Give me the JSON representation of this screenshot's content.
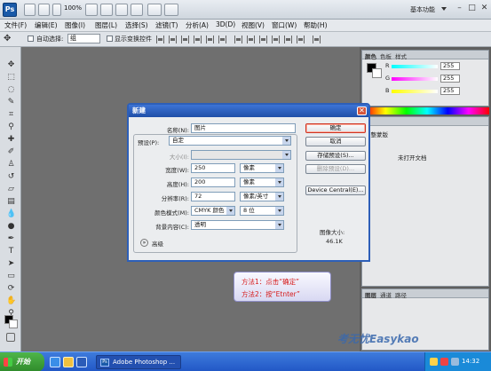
{
  "app": {
    "logo": "Ps",
    "zoom": "100%",
    "workspace": "基本功能",
    "window_controls": [
      "–",
      "□",
      "✕"
    ]
  },
  "menu": [
    "文件(F)",
    "编辑(E)",
    "图像(I)",
    "图层(L)",
    "选择(S)",
    "滤镜(T)",
    "分析(A)",
    "3D(D)",
    "视图(V)",
    "窗口(W)",
    "帮助(H)"
  ],
  "options_bar": {
    "auto_select_label": "自动选择:",
    "auto_select_value": "组",
    "show_transform_label": "显示变换控件"
  },
  "panels": {
    "color_tabs": [
      "颜色",
      "色板",
      "样式"
    ],
    "channels": [
      {
        "label": "R",
        "value": "255"
      },
      {
        "label": "G",
        "value": "255"
      },
      {
        "label": "B",
        "value": "255"
      }
    ],
    "adjust_title": "调整蒙版",
    "adjust_heading": "adjust_header",
    "adjust_text": "未打开文档",
    "layer_tabs": [
      "图层",
      "通道",
      "路径"
    ]
  },
  "dialog": {
    "title": "新建",
    "name_label": "名称(N):",
    "name_value": "图片",
    "preset_label": "预设(P):",
    "preset_value": "自定",
    "size_label": "大小(I):",
    "width_label": "宽度(W):",
    "width_value": "250",
    "width_unit": "像素",
    "height_label": "高度(H):",
    "height_value": "200",
    "height_unit": "像素",
    "resolution_label": "分辨率(R):",
    "resolution_value": "72",
    "resolution_unit": "像素/英寸",
    "color_mode_label": "颜色模式(M):",
    "color_mode_value": "CMYK 颜色",
    "bit_depth_value": "8 位",
    "background_label": "背景内容(C):",
    "background_value": "透明",
    "advanced_label": "高级",
    "ok": "确定",
    "cancel": "取消",
    "save_preset": "存储预设(S)...",
    "delete_preset": "删除预设(D)...",
    "device_central": "Device Central(E)...",
    "image_size_label": "图像大小:",
    "image_size_value": "46.1K"
  },
  "annotation": {
    "line1": "方法1：点击“确定”",
    "line2": "方法2：按“Etnter”"
  },
  "taskbar": {
    "start": "开始",
    "task_label": "Adobe Photoshop ...",
    "task_icon": "Ps",
    "clock": "14:32"
  },
  "watermark": "考无忧Easykao"
}
